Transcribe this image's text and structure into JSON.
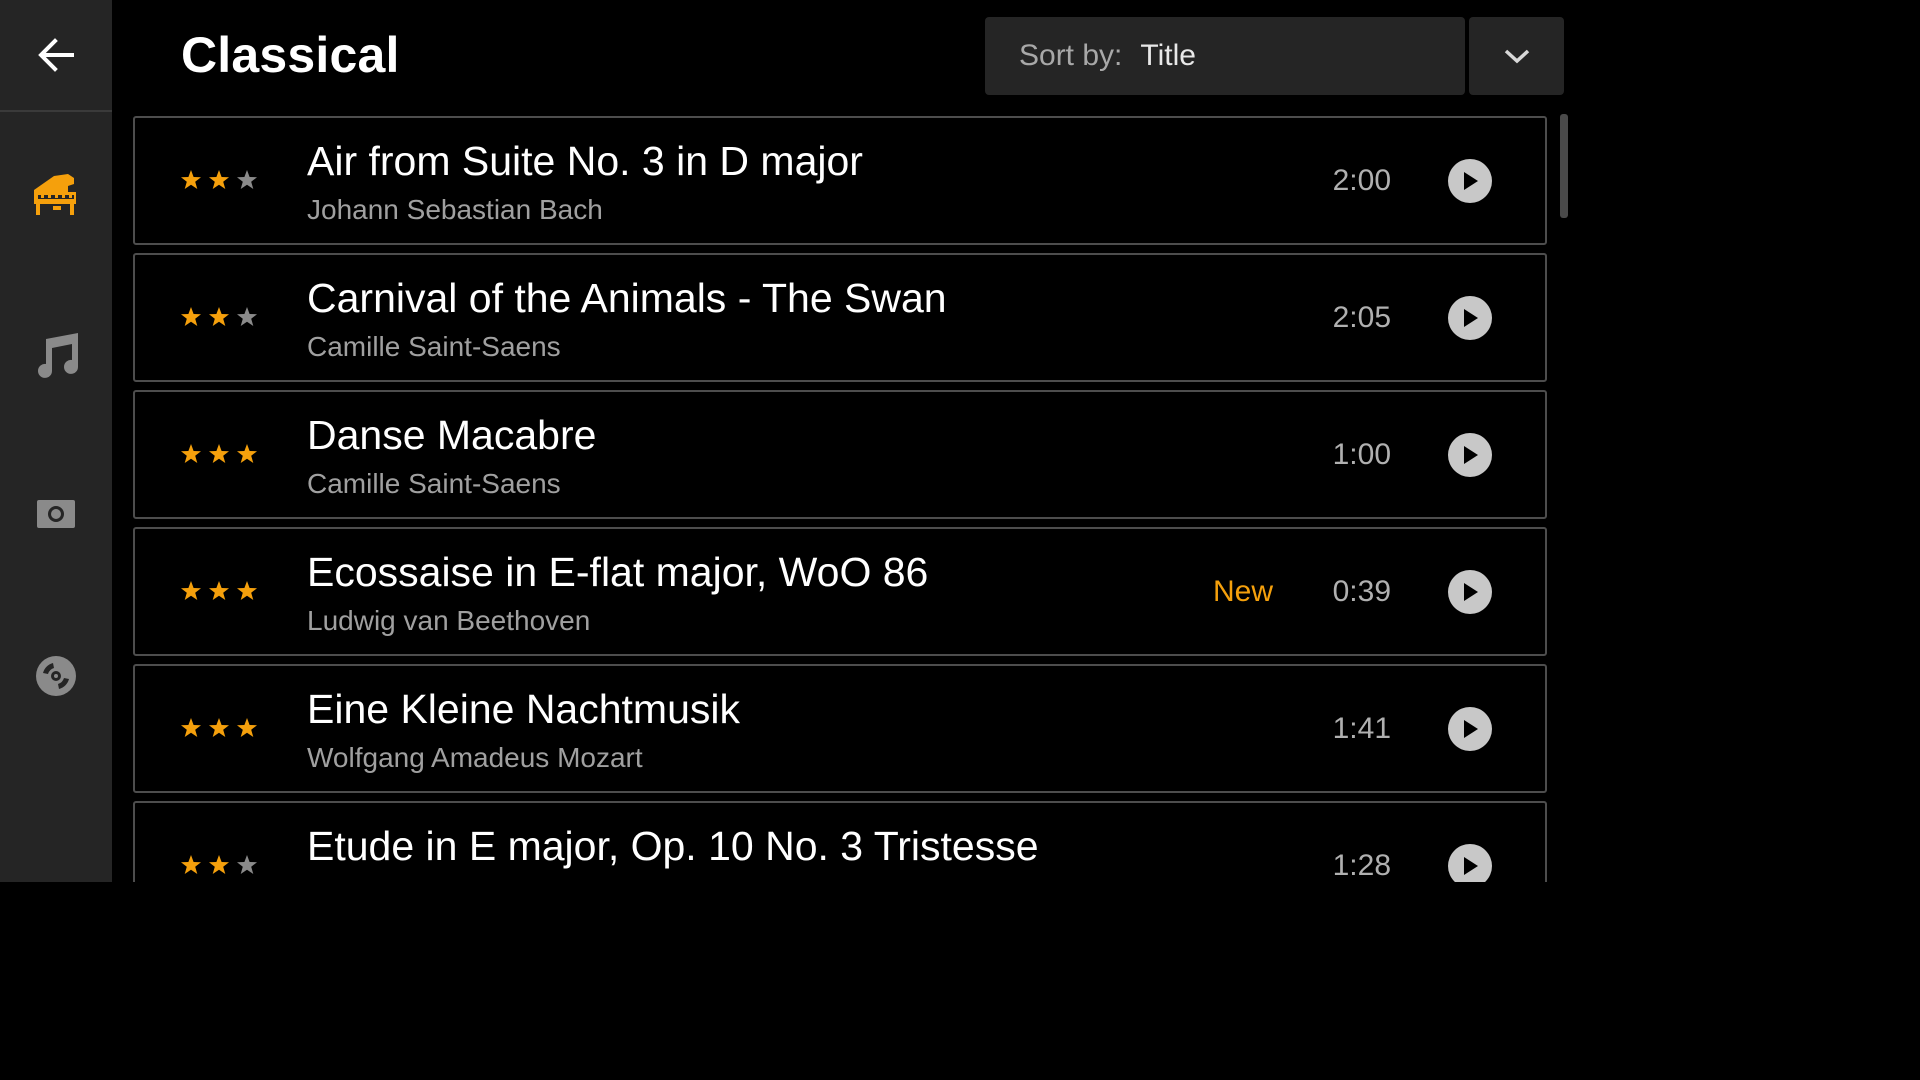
{
  "colors": {
    "accent": "#f5a00c",
    "sidebar_bg": "#252525",
    "inactive_icon": "#8a8a8a",
    "star_empty": "#8a8a8a"
  },
  "sidebar": {
    "back_icon": "arrow-left-icon",
    "items": [
      {
        "icon": "piano-icon",
        "active": true
      },
      {
        "icon": "music-note-icon",
        "active": false
      },
      {
        "icon": "camera-icon",
        "active": false
      },
      {
        "icon": "disc-icon",
        "active": false
      }
    ]
  },
  "header": {
    "title": "Classical",
    "sort_label": "Sort by:",
    "sort_value": "Title",
    "dropdown_icon": "chevron-down-icon"
  },
  "tracks": [
    {
      "title": "Air from Suite No. 3 in D major",
      "artist": "Johann Sebastian Bach",
      "duration": "2:00",
      "rating": 2,
      "max_rating": 3,
      "badge": ""
    },
    {
      "title": "Carnival of the Animals - The Swan",
      "artist": "Camille Saint-Saens",
      "duration": "2:05",
      "rating": 2,
      "max_rating": 3,
      "badge": ""
    },
    {
      "title": "Danse Macabre",
      "artist": "Camille Saint-Saens",
      "duration": "1:00",
      "rating": 3,
      "max_rating": 3,
      "badge": ""
    },
    {
      "title": "Ecossaise in E-flat major, WoO 86",
      "artist": "Ludwig van Beethoven",
      "duration": "0:39",
      "rating": 3,
      "max_rating": 3,
      "badge": "New"
    },
    {
      "title": "Eine Kleine Nachtmusik",
      "artist": "Wolfgang Amadeus Mozart",
      "duration": "1:41",
      "rating": 3,
      "max_rating": 3,
      "badge": ""
    },
    {
      "title": "Etude in E major, Op. 10 No. 3 Tristesse",
      "artist": "",
      "duration": "1:28",
      "rating": 2,
      "max_rating": 3,
      "badge": ""
    }
  ]
}
